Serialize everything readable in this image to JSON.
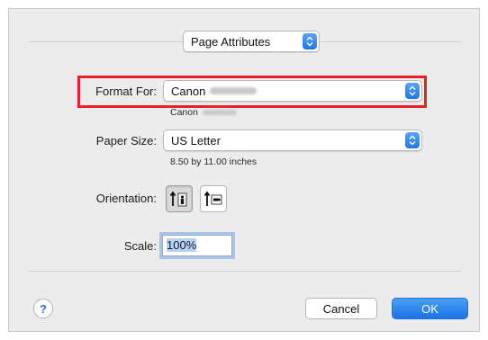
{
  "settings_popup": {
    "value": "Page Attributes"
  },
  "format_for": {
    "label": "Format For:",
    "value": "Canon",
    "detail": "Canon"
  },
  "paper_size": {
    "label": "Paper Size:",
    "value": "US Letter",
    "detail": "8.50 by 11.00 inches"
  },
  "orientation": {
    "label": "Orientation:",
    "options": [
      "portrait",
      "landscape"
    ],
    "selected": "portrait"
  },
  "scale": {
    "label": "Scale:",
    "value": "100%"
  },
  "buttons": {
    "help": "?",
    "cancel": "Cancel",
    "ok": "OK"
  },
  "colors": {
    "accent": "#1f78e8",
    "highlight_border": "#e8202a"
  },
  "icons": {
    "stepper": "up-down-arrows-icon",
    "portrait": "portrait-orientation-icon",
    "landscape": "landscape-orientation-icon"
  }
}
